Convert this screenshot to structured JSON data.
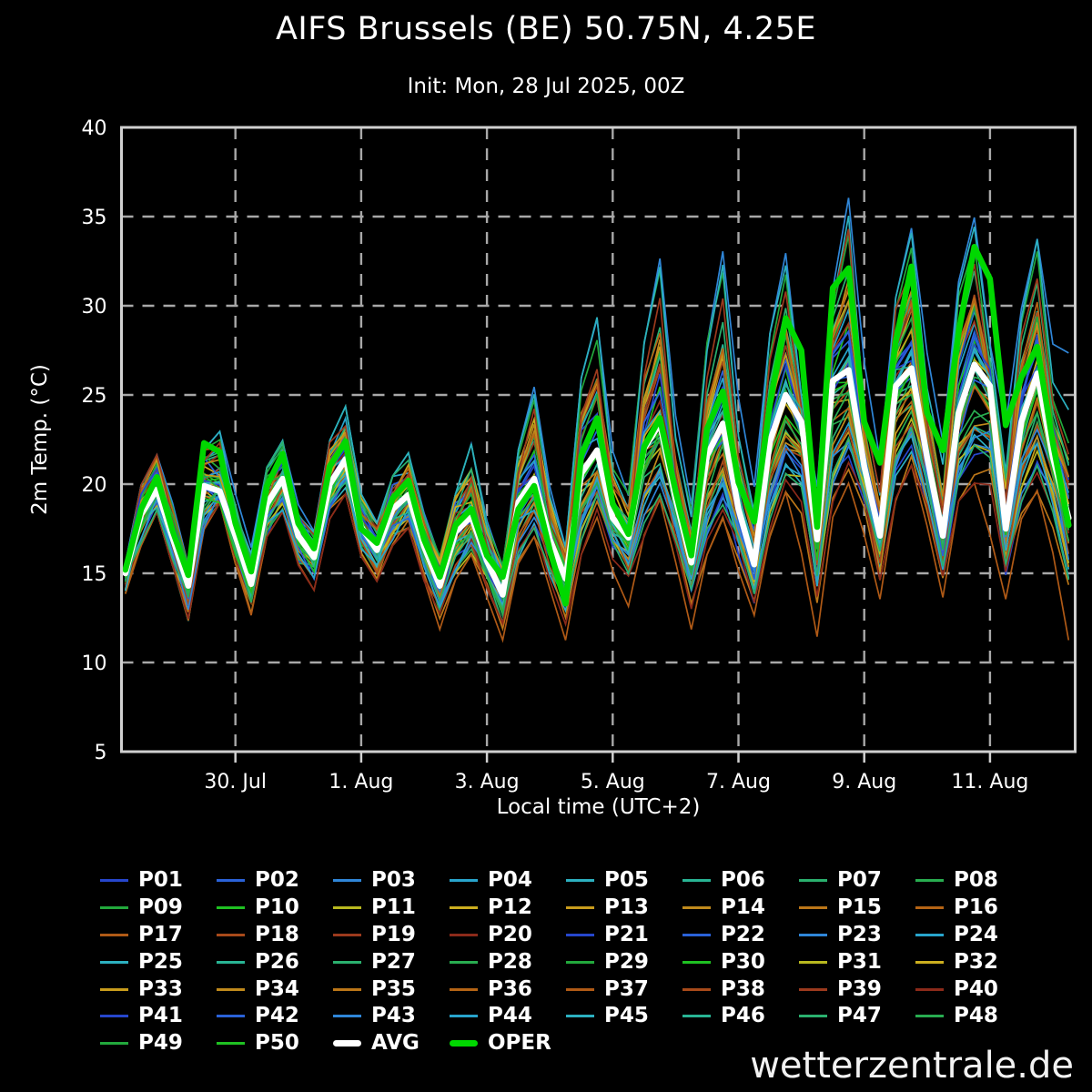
{
  "header": {
    "title": "AIFS Brussels (BE) 50.75N, 4.25E",
    "subtitle": "Init: Mon, 28 Jul 2025, 00Z"
  },
  "watermark": "wetterzentrale.de",
  "chart_data": {
    "type": "line",
    "title": "AIFS Brussels (BE) 50.75N, 4.25E",
    "subtitle": "Init: Mon, 28 Jul 2025, 00Z",
    "xlabel": "Local time (UTC+2)",
    "ylabel": "2m Temp. (°C)",
    "ylim": [
      5,
      40
    ],
    "ytick_labels": [
      40,
      35,
      30,
      25,
      20,
      15,
      10,
      5
    ],
    "ygrid_values": [
      35,
      30,
      25,
      20,
      15,
      10
    ],
    "grid": "dashed",
    "x_hours_domain": [
      0,
      364
    ],
    "x_ticks": [
      {
        "hour": 43.5,
        "label": "30. Jul"
      },
      {
        "hour": 91.5,
        "label": "1. Aug"
      },
      {
        "hour": 139.5,
        "label": "3. Aug"
      },
      {
        "hour": 187.5,
        "label": "5. Aug"
      },
      {
        "hour": 235.5,
        "label": "7. Aug"
      },
      {
        "hour": 283.5,
        "label": "9. Aug"
      },
      {
        "hour": 331.5,
        "label": "11. Aug"
      }
    ],
    "points_start_hour": 1.5,
    "step_hours": 6,
    "series": [
      {
        "name": "AVG",
        "color": "#ffffff",
        "width": 6.5,
        "values": [
          15.0,
          18.3,
          19.7,
          17.0,
          14.3,
          19.9,
          19.6,
          17.1,
          14.4,
          18.9,
          20.3,
          17.1,
          15.9,
          20.0,
          21.4,
          17.6,
          16.3,
          18.6,
          19.4,
          16.5,
          14.3,
          17.3,
          18.2,
          15.7,
          13.8,
          19.0,
          20.3,
          16.9,
          14.7,
          20.6,
          21.9,
          18.1,
          17.0,
          22.0,
          23.4,
          19.2,
          15.6,
          21.6,
          23.4,
          18.6,
          15.5,
          22.4,
          25.0,
          23.5,
          16.9,
          25.8,
          26.4,
          21.0,
          17.1,
          25.5,
          26.5,
          21.5,
          17.1,
          24.0,
          26.7,
          25.5,
          17.5,
          23.5,
          26.2,
          21.5,
          18.1
        ]
      },
      {
        "name": "OPER",
        "color": "#00d800",
        "width": 6.5,
        "values": [
          15.2,
          18.6,
          20.4,
          17.4,
          14.9,
          22.3,
          21.8,
          17.8,
          15.1,
          19.9,
          21.7,
          17.8,
          16.4,
          21.0,
          22.4,
          17.5,
          16.7,
          19.2,
          20.2,
          16.9,
          14.8,
          17.7,
          18.6,
          16.0,
          14.8,
          18.6,
          19.9,
          16.3,
          13.3,
          21.6,
          23.7,
          18.9,
          17.2,
          22.1,
          23.7,
          19.6,
          16.0,
          23.1,
          25.2,
          20.1,
          17.9,
          24.5,
          29.3,
          27.5,
          17.6,
          31.0,
          32.1,
          23.5,
          21.2,
          28.0,
          32.2,
          24.0,
          21.9,
          28.5,
          33.3,
          31.5,
          23.3,
          26.0,
          27.7,
          22.3,
          17.7
        ]
      }
    ],
    "ensemble": {
      "member_count": 50,
      "member_width": 1.7,
      "seed": 911,
      "palette20": [
        "#2646cc",
        "#2a62d8",
        "#2f86d8",
        "#28a4cc",
        "#2cb0c0",
        "#28b494",
        "#2ab06e",
        "#28ac50",
        "#22a83c",
        "#1fc122",
        "#b8b81f",
        "#ccae1f",
        "#c89c1c",
        "#c08a1c",
        "#bb7618",
        "#b56415",
        "#b05a16",
        "#a84a1a",
        "#9c3a1d",
        "#8c2a1a"
      ],
      "envelope_min": [
        13.8,
        16.5,
        18.4,
        15.4,
        12.2,
        17.4,
        18.9,
        15.4,
        12.5,
        17.0,
        18.4,
        15.4,
        14.0,
        18.0,
        19.4,
        15.9,
        14.5,
        16.5,
        17.5,
        14.5,
        11.7,
        14.6,
        16.0,
        13.5,
        11.1,
        15.5,
        17.0,
        14.0,
        11.1,
        16.0,
        18.0,
        15.0,
        13.0,
        17.0,
        19.0,
        15.5,
        11.7,
        16.0,
        18.0,
        15.0,
        12.5,
        17.0,
        19.5,
        16.0,
        11.3,
        18.0,
        20.0,
        17.0,
        13.5,
        19.0,
        21.0,
        17.5,
        13.5,
        19.0,
        20.0,
        17.0,
        13.4,
        18.0,
        19.5,
        16.0,
        11.1
      ],
      "envelope_max": [
        15.6,
        20.0,
        21.7,
        19.0,
        15.5,
        22.0,
        23.0,
        19.5,
        16.5,
        21.0,
        22.5,
        19.0,
        17.5,
        22.5,
        24.4,
        19.5,
        18.0,
        20.5,
        21.8,
        18.5,
        16.0,
        19.5,
        22.3,
        18.0,
        15.5,
        22.0,
        25.5,
        20.0,
        16.5,
        26.0,
        29.4,
        22.0,
        19.5,
        28.0,
        32.7,
        24.0,
        19.0,
        28.0,
        33.2,
        25.0,
        20.0,
        28.5,
        33.0,
        25.0,
        20.0,
        31.0,
        36.2,
        27.0,
        21.5,
        30.5,
        34.4,
        27.5,
        22.5,
        31.5,
        35.1,
        28.0,
        23.5,
        30.0,
        33.9,
        28.0,
        27.5
      ]
    },
    "legend_position": "bottom",
    "legend_items": [
      "P01",
      "P02",
      "P03",
      "P04",
      "P05",
      "P06",
      "P07",
      "P08",
      "P09",
      "P10",
      "P11",
      "P12",
      "P13",
      "P14",
      "P15",
      "P16",
      "P17",
      "P18",
      "P19",
      "P20",
      "P21",
      "P22",
      "P23",
      "P24",
      "P25",
      "P26",
      "P27",
      "P28",
      "P29",
      "P30",
      "P31",
      "P32",
      "P33",
      "P34",
      "P35",
      "P36",
      "P37",
      "P38",
      "P39",
      "P40",
      "P41",
      "P42",
      "P43",
      "P44",
      "P45",
      "P46",
      "P47",
      "P48",
      "P49",
      "P50",
      "AVG",
      "OPER"
    ]
  },
  "colors": {
    "background": "#000000",
    "frame": "#d0d0d0",
    "grid": "#a8a8a8",
    "text": "#ffffff",
    "avg": "#ffffff",
    "oper": "#00d800"
  }
}
